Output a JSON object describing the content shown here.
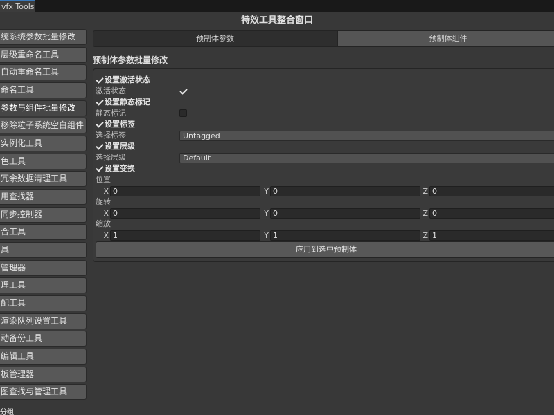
{
  "window": {
    "tab_label": "vfx Tools",
    "title": "特效工具整合窗口"
  },
  "sidebar": {
    "items": [
      {
        "label": "统系统参数批量修改"
      },
      {
        "label": "层级重命名工具"
      },
      {
        "label": "自动重命名工具"
      },
      {
        "label": "命名工具"
      },
      {
        "label": "参数与组件批量修改"
      },
      {
        "label": "移除粒子系统空白组件"
      },
      {
        "label": "实例化工具"
      },
      {
        "label": "色工具"
      },
      {
        "label": "冗余数据清理工具"
      },
      {
        "label": "用查找器"
      },
      {
        "label": "同步控制器"
      },
      {
        "label": "合工具"
      },
      {
        "label": "具"
      },
      {
        "label": "管理器"
      },
      {
        "label": "理工具"
      },
      {
        "label": "配工具"
      },
      {
        "label": "渲染队列设置工具"
      },
      {
        "label": "动备份工具"
      },
      {
        "label": "编辑工具"
      },
      {
        "label": "板管理器"
      },
      {
        "label": "图查找与管理工具"
      }
    ],
    "footer_label": "分组"
  },
  "tabs": [
    {
      "label": "预制体参数"
    },
    {
      "label": "预制体组件"
    }
  ],
  "section": {
    "title": "预制体参数批量修改"
  },
  "form": {
    "active_header": "设置激活状态",
    "active_label": "激活状态",
    "static_header": "设置静态标记",
    "static_label": "静态标记",
    "tag_header": "设置标签",
    "tag_label": "选择标签",
    "tag_value": "Untagged",
    "layer_header": "设置层级",
    "layer_label": "选择层级",
    "layer_value": "Default",
    "transform_header": "设置变换",
    "position_label": "位置",
    "rotation_label": "旋转",
    "scale_label": "缩放",
    "axis_x": "X",
    "axis_y": "Y",
    "axis_z": "Z",
    "position": {
      "x": "0",
      "y": "0",
      "z": "0"
    },
    "rotation": {
      "x": "0",
      "y": "0",
      "z": "0"
    },
    "scale": {
      "x": "1",
      "y": "1",
      "z": "1"
    },
    "apply_button": "应用到选中预制体"
  }
}
